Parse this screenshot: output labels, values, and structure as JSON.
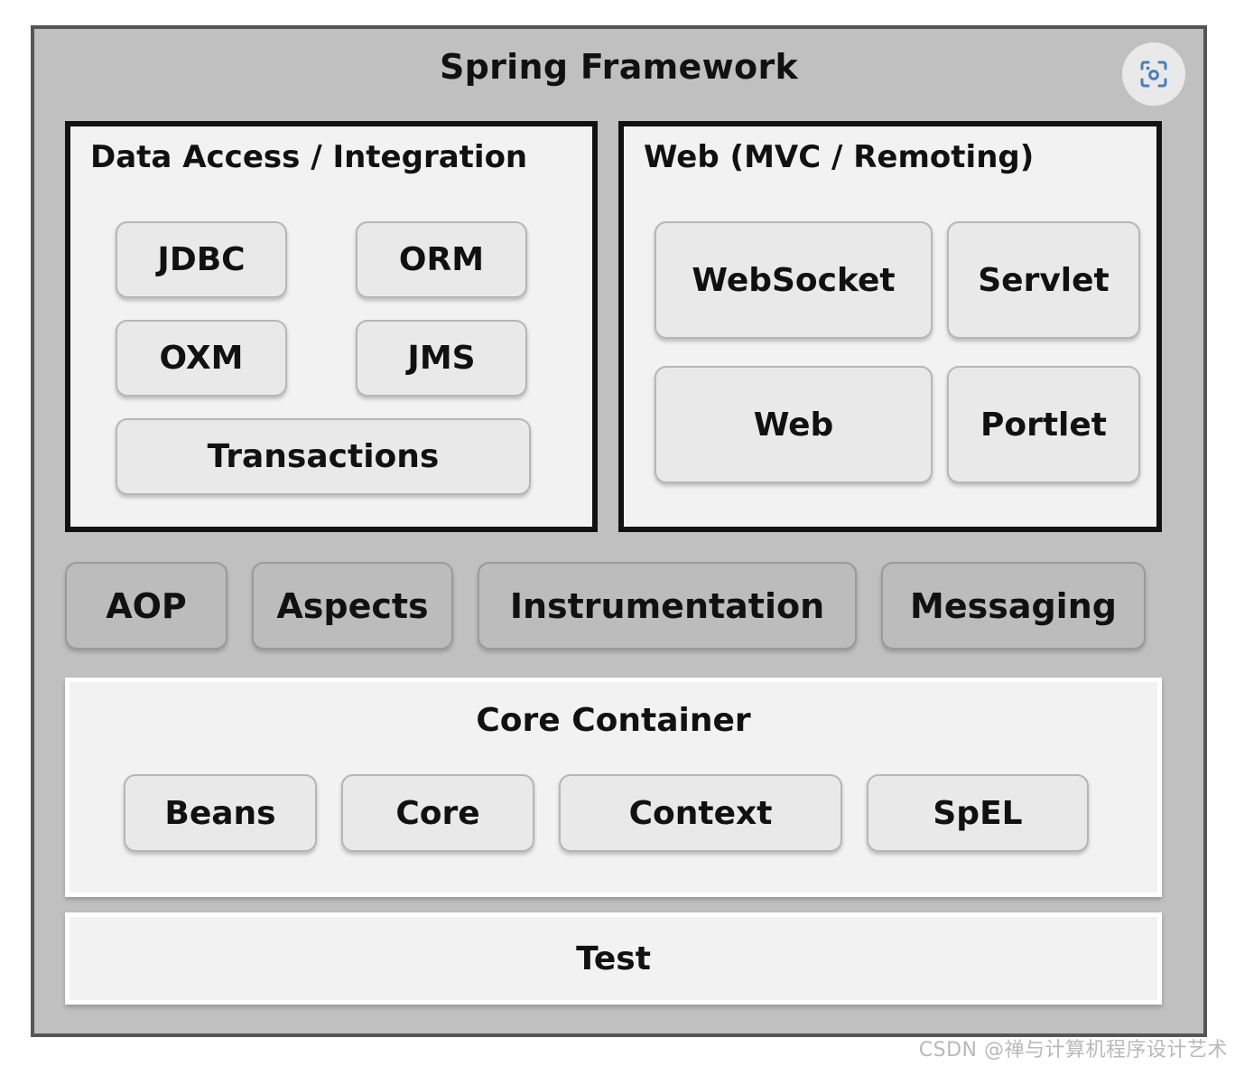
{
  "diagram": {
    "title": "Spring Framework",
    "lens_icon": "lens-scan-icon",
    "sections": {
      "data_access": {
        "heading": "Data Access / Integration",
        "modules_row1": [
          "JDBC",
          "ORM"
        ],
        "modules_row2": [
          "OXM",
          "JMS"
        ],
        "modules_wide": [
          "Transactions"
        ]
      },
      "web": {
        "heading": "Web (MVC / Remoting)",
        "modules_row1": [
          "WebSocket",
          "Servlet"
        ],
        "modules_row2": [
          "Web",
          "Portlet"
        ]
      },
      "middle": {
        "modules": [
          "AOP",
          "Aspects",
          "Instrumentation",
          "Messaging"
        ]
      },
      "core_container": {
        "heading": "Core Container",
        "modules": [
          "Beans",
          "Core",
          "Context",
          "SpEL"
        ]
      },
      "test": {
        "label": "Test"
      }
    }
  },
  "watermark": {
    "text": "CSDN @禅与计算机程序设计艺术"
  },
  "colors": {
    "frame_background": "#c0c0c0",
    "frame_border": "#555555",
    "panel_background": "#f2f2f2",
    "panel_border": "#121212",
    "chip_background": "#e9e9e9",
    "chip_border": "#b6b6b6",
    "mid_chip_background": "#bcbcbc",
    "icon_accent": "#4a7ebb",
    "text": "#111111"
  }
}
